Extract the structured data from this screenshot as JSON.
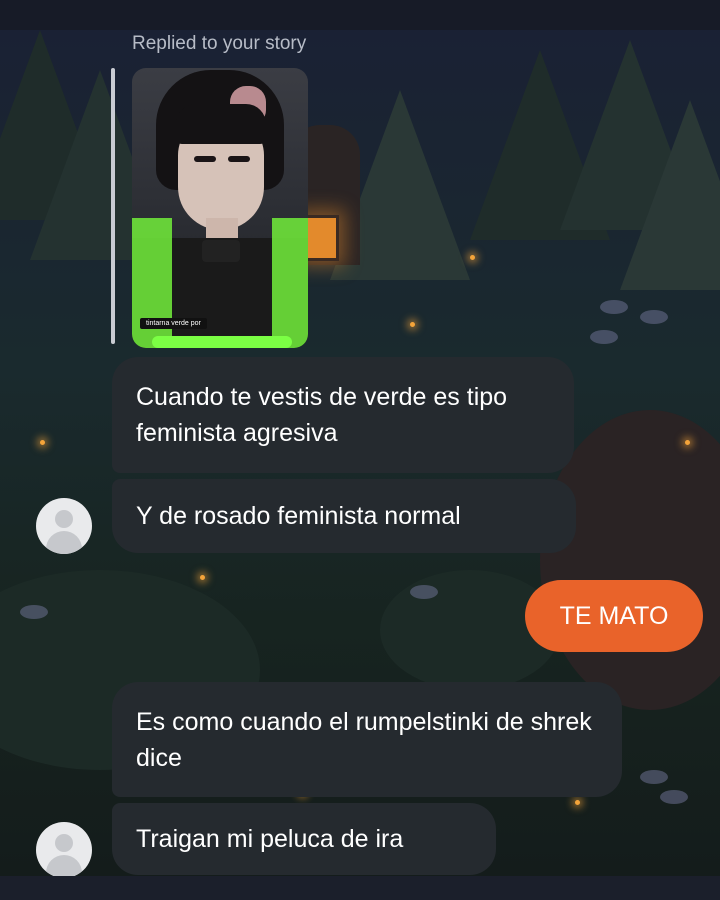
{
  "story_reply": {
    "label": "Replied to your story",
    "story_caption": "tintarna verde por"
  },
  "messages": [
    {
      "id": "m1",
      "direction": "incoming",
      "text": "Cuando te vestis de verde es tipo feminista agresiva"
    },
    {
      "id": "m2",
      "direction": "incoming",
      "text": "Y de rosado feminista normal"
    },
    {
      "id": "m3",
      "direction": "outgoing",
      "text": "TE MATO"
    },
    {
      "id": "m4",
      "direction": "incoming",
      "text": "Es como cuando el rumpelstinki de shrek dice"
    },
    {
      "id": "m5",
      "direction": "incoming",
      "text": "Traigan mi peluca de ira"
    }
  ],
  "colors": {
    "incoming_bubble": "#252a2f",
    "outgoing_bubble": "#e9632a",
    "text": "#ffffff",
    "reply_label": "#b7bcc7"
  },
  "icons": {
    "avatar": "default-avatar-icon"
  }
}
